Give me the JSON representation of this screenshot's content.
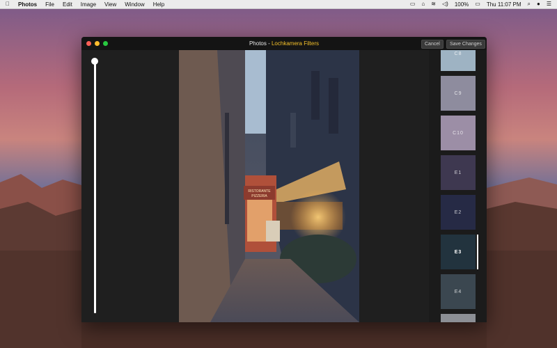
{
  "menubar": {
    "app_name": "Photos",
    "menus": [
      "File",
      "Edit",
      "Image",
      "View",
      "Window",
      "Help"
    ],
    "battery": "100%",
    "clock": "Thu 11:07 PM"
  },
  "window": {
    "title_prefix": "Photos - ",
    "title_accent": "Lochkamera Filters",
    "cancel_label": "Cancel",
    "save_label": "Save Changes"
  },
  "colors": {
    "accent": "#f4c02a",
    "close": "#fd5f57",
    "minimize": "#febc2e",
    "zoom": "#28c840"
  },
  "filters": [
    {
      "label": "C8",
      "color": "#9eb3c3"
    },
    {
      "label": "C9",
      "color": "#8e8c9e"
    },
    {
      "label": "C10",
      "color": "#9c8ea6"
    },
    {
      "label": "E1",
      "color": "#3e3850"
    },
    {
      "label": "E2",
      "color": "#262a45"
    },
    {
      "label": "E3",
      "color": "#22333e"
    },
    {
      "label": "E4",
      "color": "#3b4750"
    },
    {
      "label": "",
      "color": "#8c8f95"
    }
  ],
  "selected_filter": "E3",
  "photo_sign": {
    "line1": "RISTORANTE",
    "line2": "PIZZERIA"
  }
}
